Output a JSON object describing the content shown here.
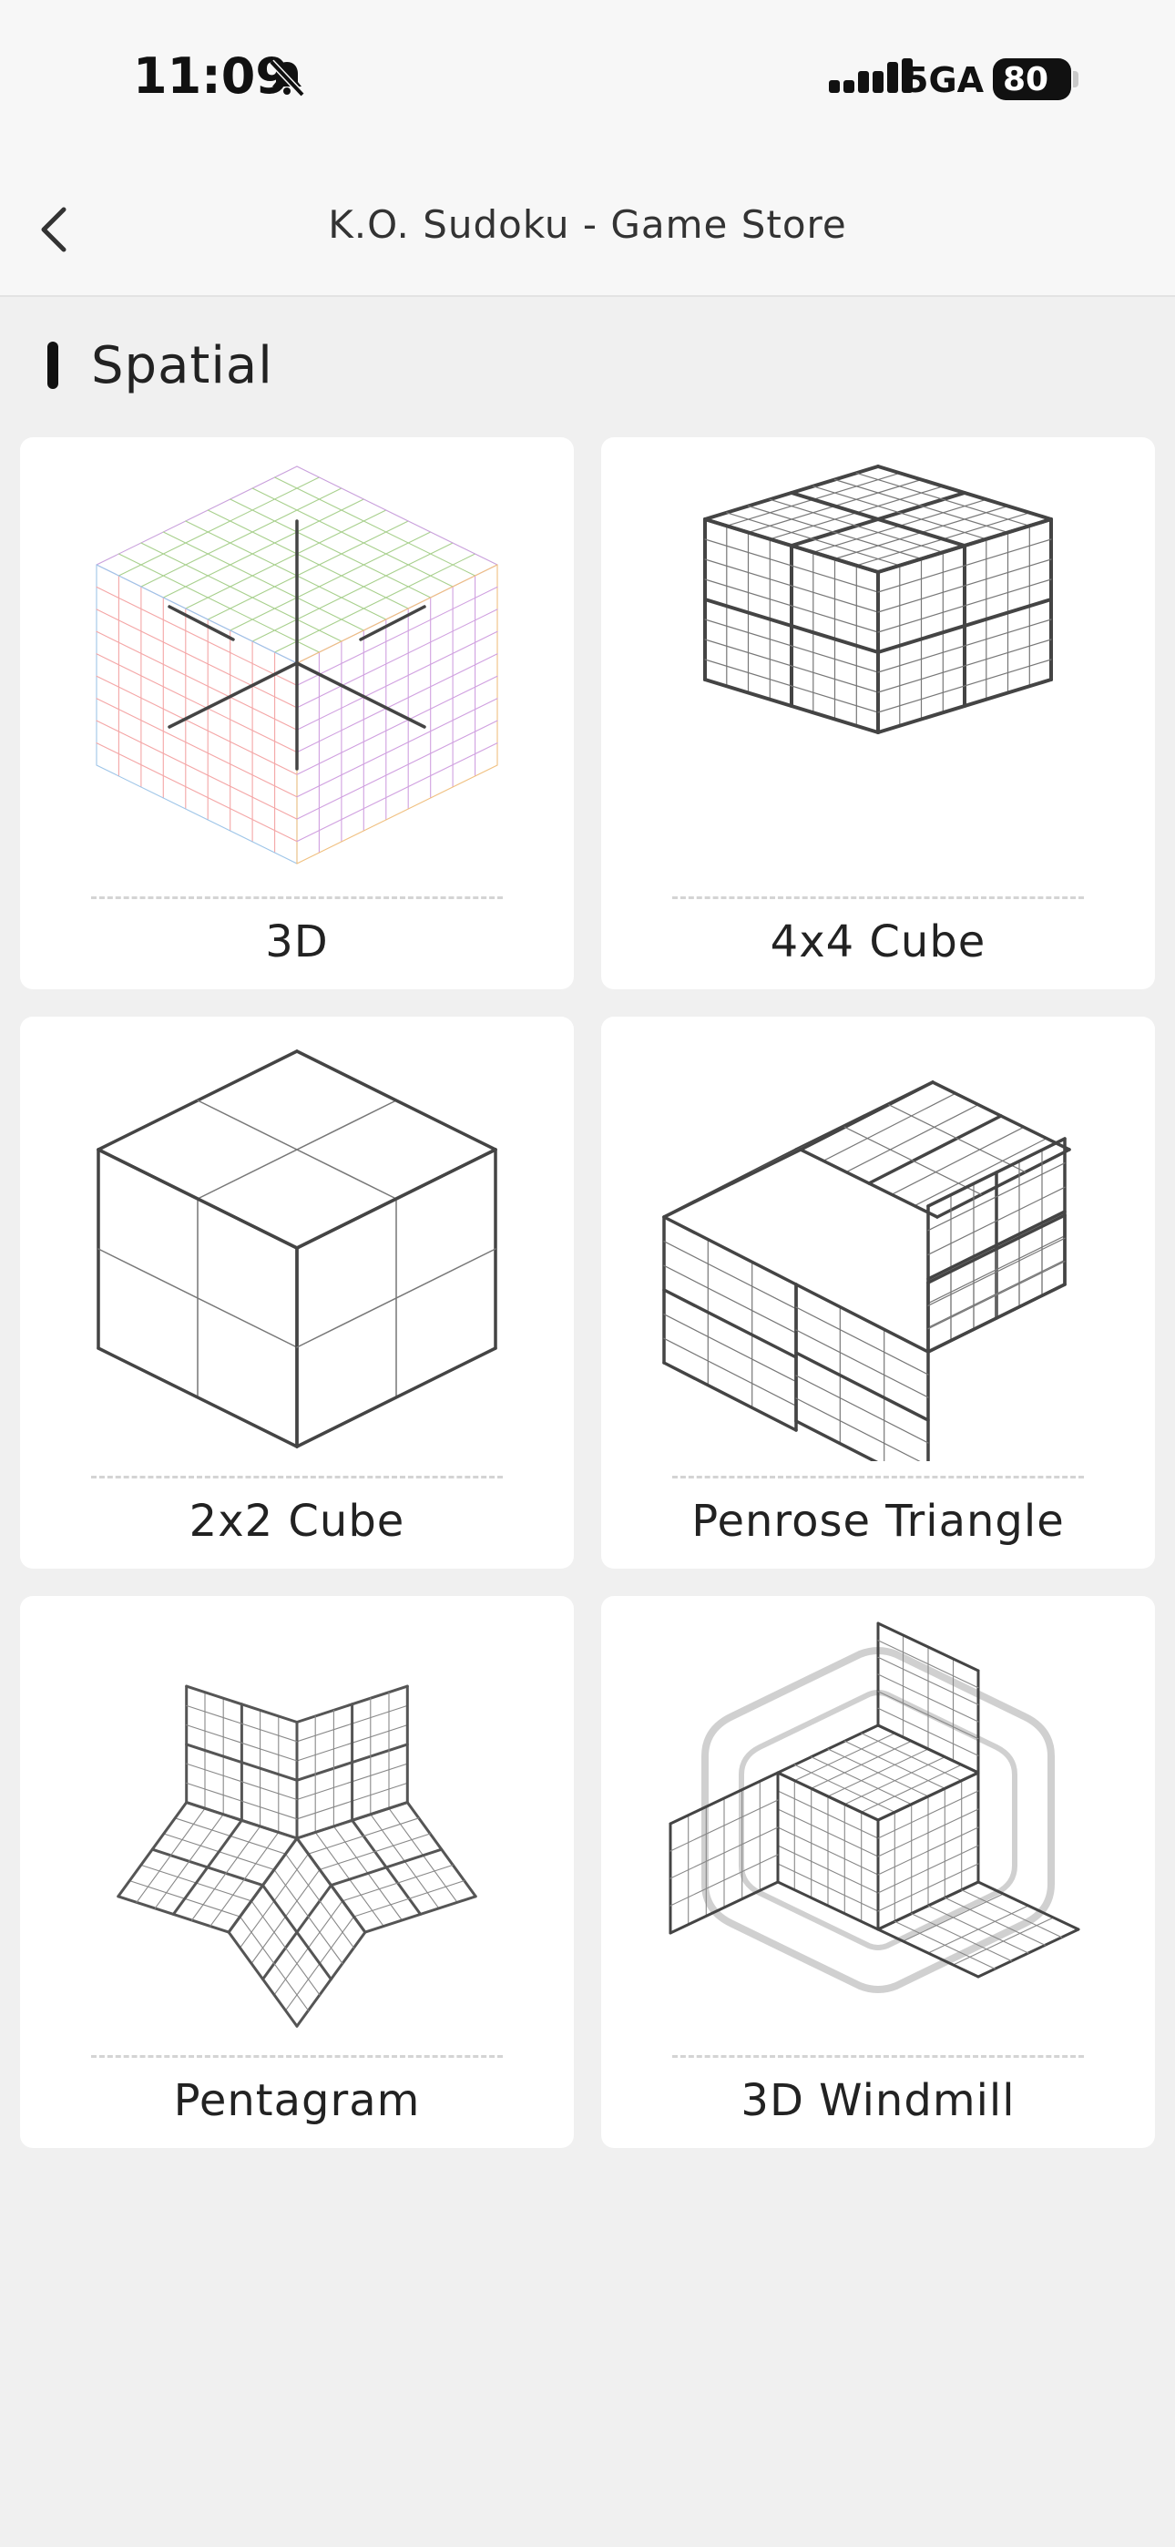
{
  "status_bar": {
    "time": "11:09",
    "network": "5GA",
    "battery": "80"
  },
  "nav": {
    "title": "K.O. Sudoku - Game Store"
  },
  "section": {
    "title": "Spatial"
  },
  "games": [
    {
      "label": "3D",
      "icon": "3d-sudoku-icon"
    },
    {
      "label": "4x4 Cube",
      "icon": "4x4-cube-icon"
    },
    {
      "label": "2x2 Cube",
      "icon": "2x2-cube-icon"
    },
    {
      "label": "Penrose Triangle",
      "icon": "penrose-triangle-icon"
    },
    {
      "label": "Pentagram",
      "icon": "pentagram-icon"
    },
    {
      "label": "3D Windmill",
      "icon": "3d-windmill-icon"
    }
  ]
}
